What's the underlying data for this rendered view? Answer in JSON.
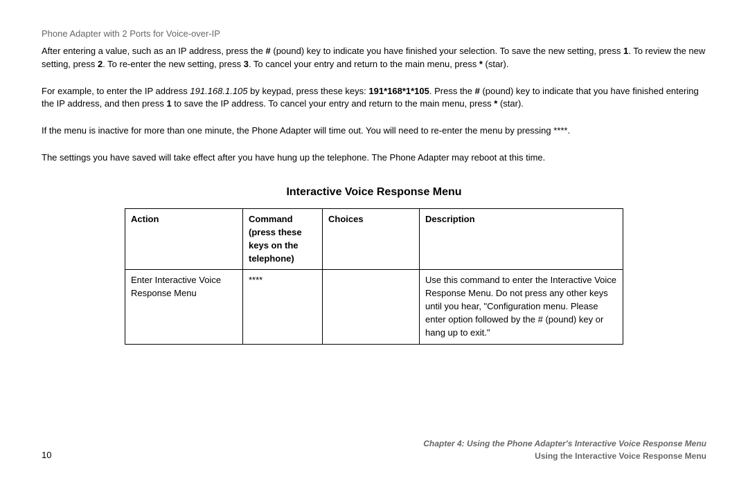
{
  "header": {
    "title": "Phone Adapter with 2 Ports for Voice-over-IP"
  },
  "paragraphs": {
    "p1_part1": "After entering a value, such as an IP address, press the ",
    "p1_hash": "#",
    "p1_part2": " (pound) key to indicate you have finished your selection. To save the new setting, press ",
    "p1_one": "1",
    "p1_part3": ". To review the new setting, press ",
    "p1_two": "2",
    "p1_part4": ". To re-enter the new setting, press ",
    "p1_three": "3",
    "p1_part5": ". To cancel your entry and return to the main menu, press ",
    "p1_star": "*",
    "p1_part6": " (star).",
    "p2_part1": "For example, to enter the IP address ",
    "p2_ip": "191.168.1.105",
    "p2_part2": " by keypad, press these keys: ",
    "p2_keys": "191*168*1*105",
    "p2_part3": ". Press the ",
    "p2_hash": "#",
    "p2_part4": " (pound) key to indicate that you have finished entering the IP address, and then press ",
    "p2_one": "1",
    "p2_part5": " to save the IP address. To cancel your entry and return to the main menu, press ",
    "p2_star": "*",
    "p2_part6": " (star).",
    "p3": "If the menu is inactive for more than one minute, the Phone Adapter will time out. You will need to re-enter the menu by pressing ****.",
    "p4": "The settings you have saved will take effect after you have hung up the telephone. The Phone Adapter may reboot at this time."
  },
  "section_heading": "Interactive Voice Response Menu",
  "table": {
    "headers": {
      "action": "Action",
      "command": "Command (press these keys on the telephone)",
      "choices": "Choices",
      "description": "Description"
    },
    "row1": {
      "action": "Enter Interactive Voice Response Menu",
      "command": "****",
      "choices": "",
      "description": "Use this command to enter the Interactive Voice Response Menu. Do not press any other keys until you hear, \"Configuration menu. Please enter option followed by the # (pound) key or hang up to exit.\""
    }
  },
  "footer": {
    "page_number": "10",
    "chapter_line": "Chapter 4: Using the Phone Adapter's Interactive Voice Response Menu",
    "subtitle_line": "Using the Interactive Voice Response Menu"
  }
}
